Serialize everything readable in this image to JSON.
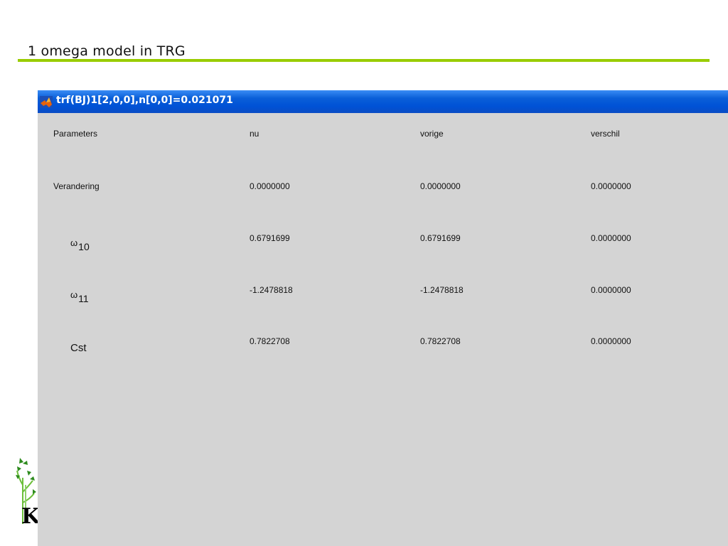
{
  "slide": {
    "title": "1 omega model in TRG"
  },
  "window": {
    "title": "trf(BJ)1[2,0,0],n[0,0]=0.021071"
  },
  "table": {
    "headers": [
      "Parameters",
      "nu",
      "vorige",
      "verschil"
    ],
    "rows": [
      {
        "label": "Verandering",
        "symbol": "",
        "subscript": "",
        "values": [
          "0.0000000",
          "0.0000000",
          "0.0000000"
        ]
      },
      {
        "label": "",
        "symbol": "ω",
        "subscript": "10",
        "values": [
          "0.6791699",
          "0.6791699",
          "0.0000000"
        ]
      },
      {
        "label": "",
        "symbol": "ω",
        "subscript": "11",
        "values": [
          "-1.2478818",
          "-1.2478818",
          "0.0000000"
        ]
      },
      {
        "label": "Cst",
        "symbol": "",
        "subscript": "",
        "values": [
          "0.7822708",
          "0.7822708",
          "0.0000000"
        ]
      }
    ]
  },
  "logo": {
    "letter": "K",
    "icon": "plant-logo-icon"
  },
  "colors": {
    "rule": "#99cc00",
    "titlebar": "#0052d6",
    "window_bg": "#d4d4d4"
  }
}
